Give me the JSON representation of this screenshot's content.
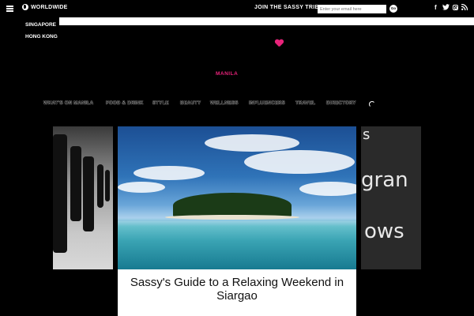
{
  "topbar": {
    "region_label": "WORLDWIDE",
    "join_label": "JOIN THE SASSY TRIBE",
    "email_placeholder": "Enter your email here",
    "go_label": "Go",
    "social": [
      "facebook-icon",
      "twitter-icon",
      "instagram-icon",
      "rss-icon"
    ]
  },
  "region_menu": {
    "items": [
      "SINGAPORE",
      "HONG KONG"
    ]
  },
  "logo": {
    "subtitle": "MANILA",
    "accent_color": "#e8237a"
  },
  "nav": {
    "items": [
      "WHAT'S ON MANILA",
      "FOOD & DRINK",
      "STYLE",
      "BEAUTY",
      "WELLNESS",
      "INFLUENCERS",
      "TRAVEL",
      "DIRECTORY"
    ]
  },
  "carousel": {
    "featured_title": "Sassy's Guide to a Relaxing Weekend in Siargao",
    "right_slide_text": [
      "gran",
      "ows"
    ]
  }
}
